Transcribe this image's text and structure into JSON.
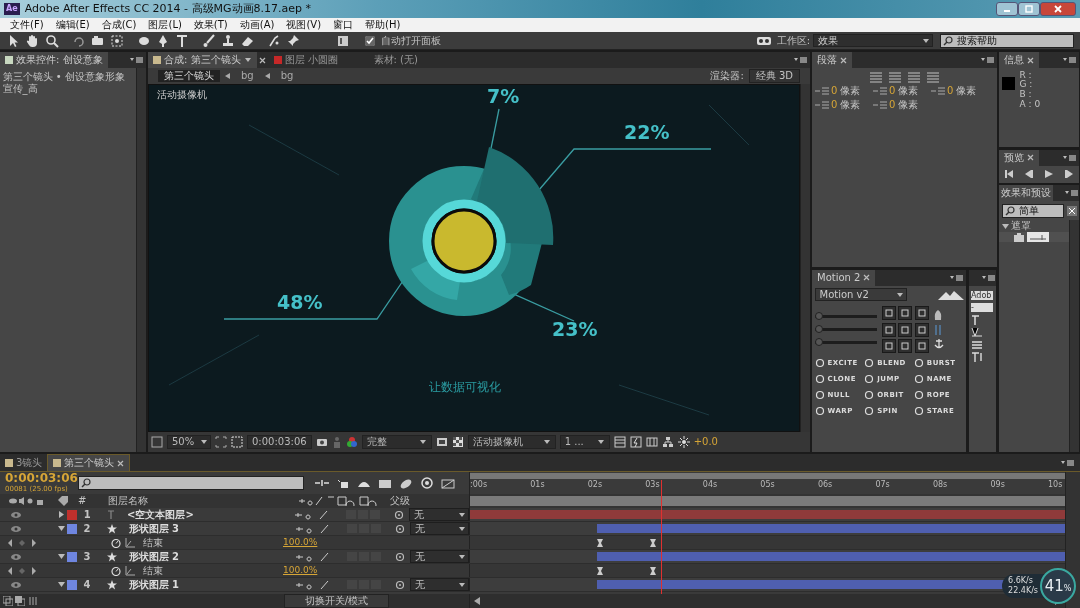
{
  "window": {
    "app_icon": "Ae",
    "title": "Adobe After Effects CC 2014 - 高级MG动画8.17.aep *"
  },
  "menu": [
    "文件(F)",
    "编辑(E)",
    "合成(C)",
    "图层(L)",
    "效果(T)",
    "动画(A)",
    "视图(V)",
    "窗口",
    "帮助(H)"
  ],
  "toolbar": {
    "auto_open_panels": {
      "label": "自动打开面板",
      "checked": true
    },
    "workspace_label": "工作区:",
    "workspace": "效果",
    "search": {
      "placeholder": "搜索帮助"
    }
  },
  "effect_controls": {
    "tab": "效果控件: 创设意象",
    "path": "第三个镜头 • 创设意象形象宣传_高"
  },
  "composition": {
    "tabs": [
      {
        "label": "合成: 第三个镜头",
        "selected": true
      },
      {
        "label": "图层 小圆圈",
        "selected": false
      },
      {
        "label": "素材: (无)",
        "selected": false
      }
    ],
    "breadcrumbs": [
      {
        "label": "第三个镜头",
        "selected": true
      },
      {
        "label": "bg",
        "selected": false
      },
      {
        "label": "bg",
        "selected": false
      }
    ],
    "renderer_label": "渲染器:",
    "renderer": "经典 3D",
    "camera_label": "活动摄像机",
    "labels": [
      "7%",
      "22%",
      "48%",
      "23%"
    ],
    "caption": "让数据可视化",
    "footer": {
      "zoom": "50%",
      "timecode": "0:00:03:06",
      "resolution": "完整",
      "view": "活动摄像机",
      "views": "1 ...",
      "exposure": "+0.0"
    }
  },
  "paragraph": {
    "tab": "段落",
    "indents": [
      {
        "value": "0",
        "unit": "像素"
      },
      {
        "value": "0",
        "unit": "像素"
      },
      {
        "value": "0",
        "unit": "像素"
      },
      {
        "value": "0",
        "unit": "像素"
      },
      {
        "value": "0",
        "unit": "像素"
      }
    ]
  },
  "motion": {
    "tab": "Motion 2",
    "preset": "Motion v2",
    "sliders": [
      {
        "level": 0
      },
      {
        "level": 0
      },
      {
        "level": 0
      }
    ],
    "buttons": [
      "EXCITE",
      "BLEND",
      "BURST",
      "CLONE",
      "JUMP",
      "NAME",
      "NULL",
      "ORBIT",
      "ROPE",
      "WARP",
      "SPIN",
      "STARE"
    ]
  },
  "character": {
    "font": "Adob",
    "style": "-"
  },
  "info": {
    "tab": "信息",
    "channels": [
      "R :",
      "G :",
      "B :",
      "A : 0"
    ]
  },
  "preview": {
    "tab": "预览"
  },
  "effects_presets": {
    "tab": "效果和预设",
    "search": "简单",
    "tree": [
      {
        "label": "遮罩",
        "expanded": true,
        "children": [
          {
            "kind": "preset"
          }
        ]
      }
    ]
  },
  "timeline": {
    "tabs": [
      {
        "label": "3镜头",
        "selected": false
      },
      {
        "label": "第三个镜头",
        "selected": true
      }
    ],
    "timecode": "0:00:03:06",
    "frame_info": "00081 (25.00 fps)",
    "columns": [
      "#",
      "图层名称",
      "父级"
    ],
    "ruler": [
      ":00s",
      "01s",
      "02s",
      "03s",
      "04s",
      "05s",
      "06s",
      "07s",
      "08s",
      "09s",
      "10s"
    ],
    "playhead": {
      "level": 0.323
    },
    "layers": [
      {
        "number": "1",
        "kind": "text",
        "name": "<空文本图层>",
        "color": "#c0302c",
        "expanded": false,
        "parent": "无",
        "level": 1
      },
      {
        "number": "2",
        "kind": "shape",
        "name": "形状图层 3",
        "color": "#6f86e0",
        "expanded": true,
        "parent": "无",
        "level": 0.786,
        "properties": [
          {
            "name": "结束",
            "value": "100.0%"
          }
        ]
      },
      {
        "number": "3",
        "kind": "shape",
        "name": "形状图层 2",
        "color": "#6f86e0",
        "expanded": true,
        "parent": "无",
        "level": 0.786,
        "properties": [
          {
            "name": "结束",
            "value": "100.0%"
          }
        ]
      },
      {
        "number": "4",
        "kind": "shape",
        "name": "形状图层 1",
        "color": "#6f86e0",
        "expanded": true,
        "parent": "无",
        "level": 0.786
      }
    ],
    "toggle_label": "切换开关/模式"
  },
  "net_speed": {
    "upload": "6.6K/s",
    "download": "22.4K/s",
    "percent": "41",
    "unit": "%"
  }
}
